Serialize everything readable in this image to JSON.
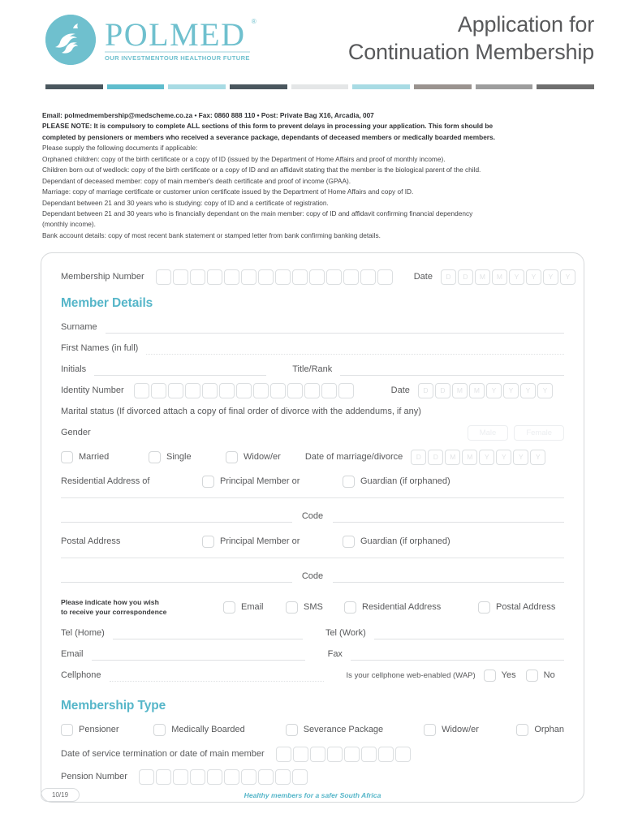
{
  "header": {
    "title_line1": "Application for",
    "title_line2": "Continuation Membership",
    "logo": {
      "brand": "POLMED",
      "registered": "®",
      "tagline1": "OUR INVESTMENT",
      "tagline2": "OUR HEALTH",
      "tagline3": "OUR FUTURE",
      "mark": "dolphins-circle-logo"
    },
    "colorbar": [
      "#4a575e",
      "#5fbdcd",
      "#a8dbe4",
      "#4a575e",
      "#e4e6e7",
      "#a8dbe4",
      "#9a938f",
      "#9d9d9d",
      "#6f6f6f"
    ]
  },
  "intro": {
    "contact": "Email: polmedmembership@medscheme.co.za • Fax: 0860 888 110 • Post: Private Bag X16, Arcadia, 007",
    "note_label": "PLEASE NOTE:",
    "note_line1": " It is compulsory to complete ALL sections of this form to prevent delays in processing your application. This form should be",
    "note_line2": "completed by pensioners or members who received a severance package, dependants of deceased members or medically boarded members.",
    "supply": "Please supply the following documents if applicable:",
    "docs": [
      "Orphaned children: copy of the birth certificate or a copy of ID (issued by the Department of Home Affairs and proof of monthly income).",
      "Children born out of wedlock: copy of the birth certificate or a copy of ID and an affidavit stating that the member is the biological parent of the child.",
      "Dependant of deceased member: copy of main member's death certificate and proof of income (GPAA).",
      "Marriage: copy of marriage certificate or customer union certificate issued by the Department of Home Affairs and copy of ID.",
      "Dependant between 21 and 30 years who is studying: copy of ID and a certificate of registration.",
      "Dependant between 21 and 30 years who is financially dependant on the main member: copy of ID and affidavit confirming financial dependency",
      "(monthly income).",
      "Bank account details: copy of most recent bank statement or stamped letter from bank confirming banking details."
    ]
  },
  "form": {
    "membership_number_label": "Membership Number",
    "membership_number_boxes": 14,
    "date_label": "Date",
    "date_mask": [
      "D",
      "D",
      "M",
      "M",
      "Y",
      "Y",
      "Y",
      "Y"
    ],
    "member_details_title": "Member Details",
    "surname_label": "Surname",
    "first_names_label": "First Names (in full)",
    "initials_label": "Initials",
    "title_rank_label": "Title/Rank",
    "identity_number_label": "Identity Number",
    "identity_number_boxes": 13,
    "marital_status_label": "Marital status (If divorced attach a copy of final order of divorce with the addendums, if any)",
    "gender_label": "Gender",
    "gender_options": [
      "Male",
      "Female"
    ],
    "marital_options": [
      "Married",
      "Single",
      "Widow/er"
    ],
    "date_marriage_label": "Date of marriage/divorce",
    "residential_address_label": "Residential Address of",
    "postal_address_label": "Postal Address",
    "principal_member_label": "Principal Member or",
    "guardian_label": "Guardian (if orphaned)",
    "code_label": "Code",
    "correspondence_label_l1": "Please indicate how you wish",
    "correspondence_label_l2": "to receive your correspondence",
    "correspondence_options": [
      "Email",
      "SMS",
      "Residential Address",
      "Postal Address"
    ],
    "tel_home_label": "Tel (Home)",
    "tel_work_label": "Tel (Work)",
    "email_label": "Email",
    "fax_label": "Fax",
    "cellphone_label": "Cellphone",
    "wap_label": "Is your cellphone web-enabled (WAP)",
    "wap_yes": "Yes",
    "wap_no": "No",
    "membership_type_title": "Membership Type",
    "membership_type_options": [
      "Pensioner",
      "Medically Boarded",
      "Severance Package",
      "Widow/er",
      "Orphan"
    ],
    "service_termination_label": "Date of service termination or date of main member",
    "service_termination_boxes": 8,
    "pension_number_label": "Pension Number",
    "pension_number_boxes": 10
  },
  "footer": {
    "page_code": "10/19",
    "tagline": "Healthy members for a safer South Africa"
  },
  "colors": {
    "accent": "#56b6c9",
    "logo": "#6fc0ce",
    "text": "#58595b"
  }
}
